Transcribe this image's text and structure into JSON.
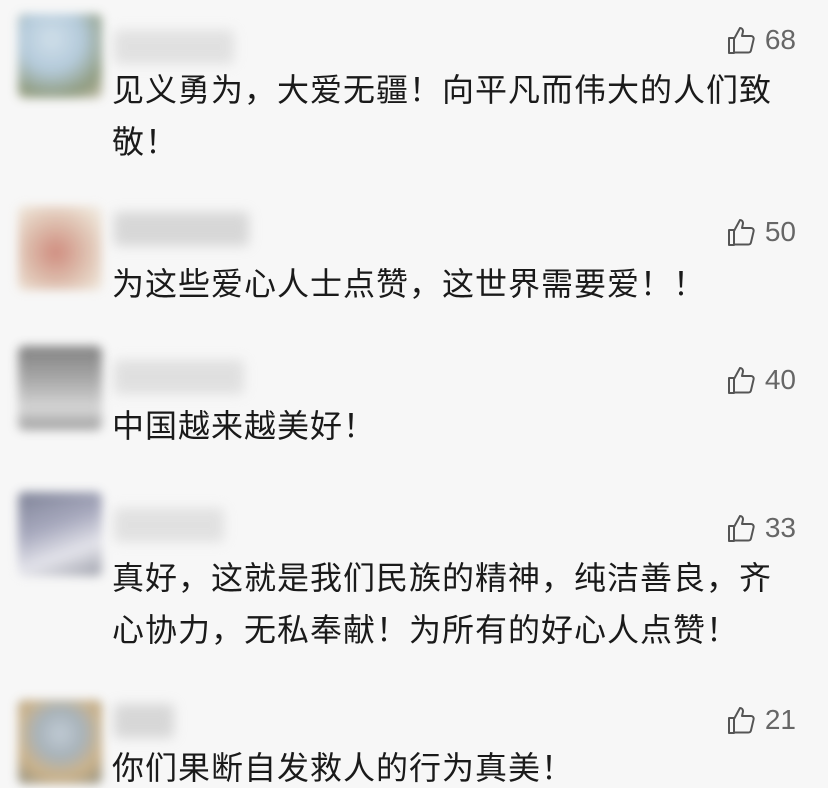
{
  "comments": [
    {
      "nickname": "",
      "likes": "68",
      "text": "见义勇为，大爱无疆！向平凡而伟大的人们致敬！"
    },
    {
      "nickname": "",
      "likes": "50",
      "text": "为这些爱心人士点赞，这世界需要爱！！"
    },
    {
      "nickname": "",
      "likes": "40",
      "text": "中国越来越美好！"
    },
    {
      "nickname": "",
      "likes": "33",
      "text": "真好，这就是我们民族的精神，纯洁善良，齐心协力，无私奉献！为所有的好心人点赞！"
    },
    {
      "nickname": "",
      "likes": "21",
      "text": "你们果断自发救人的行为真美！"
    }
  ],
  "colors": {
    "background": "#f7f7f7",
    "text": "#1a1a1a",
    "meta": "#666666"
  },
  "icons": {
    "like": "thumbs-up-icon"
  }
}
